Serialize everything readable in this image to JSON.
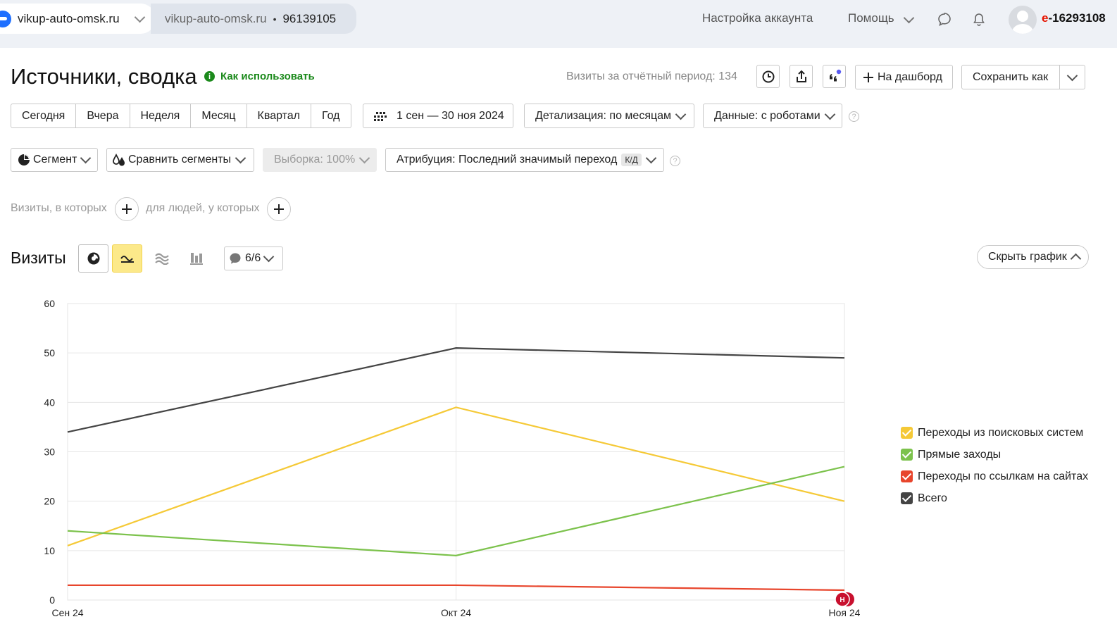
{
  "topbar": {
    "site_name": "vikup-auto-omsk.ru",
    "counter_domain": "vikup-auto-omsk.ru",
    "counter_dot": "•",
    "counter_id": "96139105",
    "account_settings": "Настройка аккаунта",
    "help": "Помощь",
    "user_login_first": "e",
    "user_login_rest": "-16293108"
  },
  "header": {
    "title": "Источники, сводка",
    "howto_label": "Как использовать",
    "visits_period": "Визиты за отчётный период: 134",
    "add_dashboard": "На дашборд",
    "save_as": "Сохранить как"
  },
  "periods": [
    "Сегодня",
    "Вчера",
    "Неделя",
    "Месяц",
    "Квартал",
    "Год"
  ],
  "date_range": "1 сен — 30 ноя 2024",
  "detail": "Детализация: по месяцам",
  "data_mode": "Данные: с роботами",
  "segment": "Сегмент",
  "compare_segments": "Сравнить сегменты",
  "sample": "Выборка: 100%",
  "attribution": "Атрибуция: Последний значимый переход",
  "attribution_badge": "К/Д",
  "filters": {
    "visits_where": "Визиты, в которых",
    "people_where": "для людей, у которых"
  },
  "chart_section": {
    "title": "Визиты",
    "annotations_count": "6/6",
    "hide_chart": "Скрыть график"
  },
  "colors": {
    "search": "#f5c936",
    "direct": "#7cc24c",
    "links": "#e8452c",
    "total": "#444444",
    "accent_green": "#1c8a1c"
  },
  "chart_data": {
    "type": "line",
    "categories": [
      "Сен 24",
      "Окт 24",
      "Ноя 24"
    ],
    "ylim": [
      0,
      60
    ],
    "yticks": [
      0,
      10,
      20,
      30,
      40,
      50,
      60
    ],
    "grid": true,
    "legend_position": "right",
    "series": [
      {
        "name": "Переходы из поисковых систем",
        "values": [
          11,
          39,
          20
        ],
        "color": "#f5c936"
      },
      {
        "name": "Прямые заходы",
        "values": [
          14,
          9,
          27
        ],
        "color": "#7cc24c"
      },
      {
        "name": "Переходы по ссылкам на сайтах",
        "values": [
          3,
          3,
          2
        ],
        "color": "#e8452c"
      },
      {
        "name": "Всего",
        "values": [
          34,
          51,
          49
        ],
        "color": "#444444"
      }
    ],
    "annotation_marker": "Н"
  }
}
